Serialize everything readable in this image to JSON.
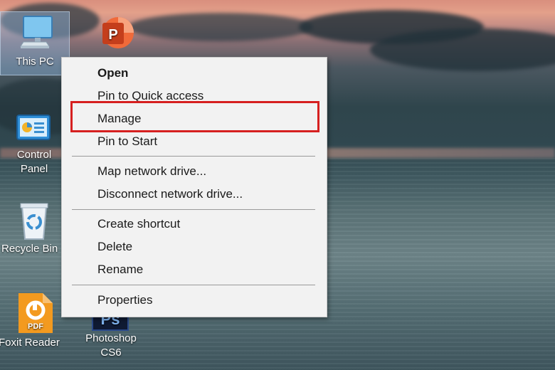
{
  "desktop": {
    "icons": [
      {
        "label_lines": [
          "This PC"
        ],
        "icon": "this-pc-icon"
      },
      {
        "label_lines": [
          "Control",
          "Panel"
        ],
        "icon": "control-panel-icon"
      },
      {
        "label_lines": [
          "Recycle Bin"
        ],
        "icon": "recycle-bin-icon"
      },
      {
        "label_lines": [
          "Foxit Reader"
        ],
        "icon": "foxit-reader-icon"
      },
      {
        "label_lines": [
          "Photoshop",
          "CS6"
        ],
        "icon": "photoshop-icon"
      },
      {
        "label_lines": [],
        "icon": "powerpoint-icon"
      }
    ],
    "foxit_badge": "PDF",
    "powerpoint_letter": "P"
  },
  "context_menu": {
    "items": [
      {
        "label": "Open"
      },
      {
        "label": "Pin to Quick access"
      },
      {
        "label": "Manage"
      },
      {
        "label": "Pin to Start"
      },
      {
        "label": "Map network drive..."
      },
      {
        "label": "Disconnect network drive..."
      },
      {
        "label": "Create shortcut"
      },
      {
        "label": "Delete"
      },
      {
        "label": "Rename"
      },
      {
        "label": "Properties"
      }
    ],
    "highlight_color": "#d62020"
  }
}
